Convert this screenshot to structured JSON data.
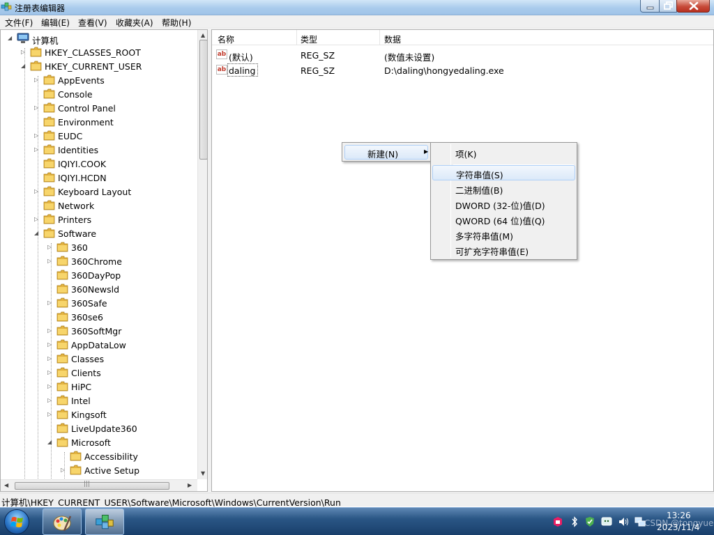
{
  "window": {
    "title": "注册表编辑器",
    "icon": "regedit-icon"
  },
  "menubar": [
    "文件(F)",
    "编辑(E)",
    "查看(V)",
    "收藏夹(A)",
    "帮助(H)"
  ],
  "tree": {
    "root": "计算机",
    "nodes": [
      {
        "label": "HKEY_CLASSES_ROOT"
      },
      {
        "label": "HKEY_CURRENT_USER"
      },
      {
        "label": "AppEvents"
      },
      {
        "label": "Console"
      },
      {
        "label": "Control Panel"
      },
      {
        "label": "Environment"
      },
      {
        "label": "EUDC"
      },
      {
        "label": "Identities"
      },
      {
        "label": "IQIYI.COOK"
      },
      {
        "label": "IQIYI.HCDN"
      },
      {
        "label": "Keyboard Layout"
      },
      {
        "label": "Network"
      },
      {
        "label": "Printers"
      },
      {
        "label": "Software"
      },
      {
        "label": "360"
      },
      {
        "label": "360Chrome"
      },
      {
        "label": "360DayPop"
      },
      {
        "label": "360Newsld"
      },
      {
        "label": "360Safe"
      },
      {
        "label": "360se6"
      },
      {
        "label": "360SoftMgr"
      },
      {
        "label": "AppDataLow"
      },
      {
        "label": "Classes"
      },
      {
        "label": "Clients"
      },
      {
        "label": "HiPC"
      },
      {
        "label": "Intel"
      },
      {
        "label": "Kingsoft"
      },
      {
        "label": "LiveUpdate360"
      },
      {
        "label": "Microsoft"
      },
      {
        "label": "Accessibility"
      },
      {
        "label": "Active Setup"
      }
    ]
  },
  "listview": {
    "columns": [
      "名称",
      "类型",
      "数据"
    ],
    "rows": [
      {
        "name": "(默认)",
        "type": "REG_SZ",
        "data": "(数值未设置)"
      },
      {
        "name": "daling",
        "type": "REG_SZ",
        "data": "D:\\daling\\hongyedaling.exe"
      }
    ]
  },
  "context_menu": {
    "new_label": "新建(N)",
    "submenu": [
      "项(K)",
      "字符串值(S)",
      "二进制值(B)",
      "DWORD (32-位)值(D)",
      "QWORD (64 位)值(Q)",
      "多字符串值(M)",
      "可扩充字符串值(E)"
    ],
    "highlighted": "字符串值(S)"
  },
  "statusbar": {
    "path": "计算机\\HKEY_CURRENT_USER\\Software\\Microsoft\\Windows\\CurrentVersion\\Run"
  },
  "taskbar": {
    "buttons": [
      "paint-icon",
      "regedit-icon"
    ],
    "tray_icons": [
      "security-icon",
      "bluetooth-icon",
      "safety-shield-icon",
      "wechat-icon",
      "volume-icon",
      "network-icon"
    ],
    "time": "13:26",
    "date": "2023/11/4",
    "watermark": "CSDN @tongyue"
  }
}
